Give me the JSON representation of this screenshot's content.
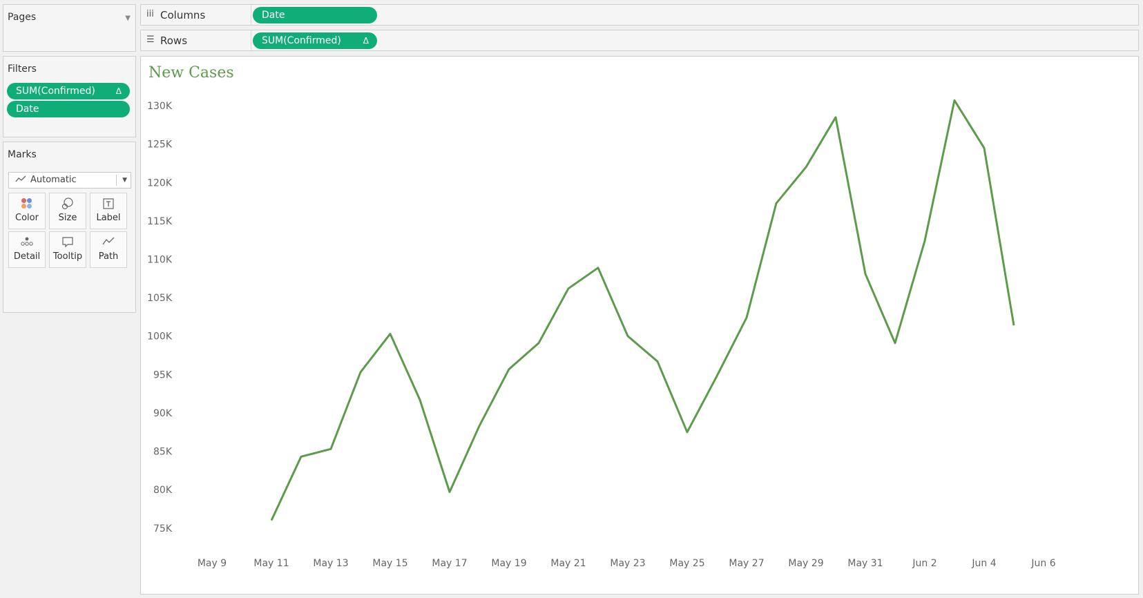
{
  "pages": {
    "title": "Pages"
  },
  "filters": {
    "title": "Filters",
    "pills": [
      {
        "label": "SUM(Confirmed)",
        "badge": "Δ"
      },
      {
        "label": "Date"
      }
    ]
  },
  "marks": {
    "title": "Marks",
    "type_selector": "Automatic",
    "buttons": [
      "Color",
      "Size",
      "Label",
      "Detail",
      "Tooltip",
      "Path"
    ]
  },
  "shelves": {
    "columns": {
      "label": "Columns",
      "pill": "Date"
    },
    "rows": {
      "label": "Rows",
      "pill": "SUM(Confirmed)",
      "badge": "Δ"
    }
  },
  "colors": {
    "accent": "#10ad78",
    "line": "#5d9b4c"
  },
  "chart_data": {
    "type": "line",
    "title": "New Cases",
    "xlabel": "",
    "ylabel": "",
    "x_tick_labels": [
      "May 9",
      "May 11",
      "May 13",
      "May 15",
      "May 17",
      "May 19",
      "May 21",
      "May 23",
      "May 25",
      "May 27",
      "May 29",
      "May 31",
      "Jun 2",
      "Jun 4",
      "Jun 6"
    ],
    "y_tick_labels": [
      "75K",
      "80K",
      "85K",
      "90K",
      "95K",
      "100K",
      "105K",
      "110K",
      "115K",
      "120K",
      "125K",
      "130K"
    ],
    "ylim": [
      73000,
      131000
    ],
    "xlim": [
      "2020-05-08",
      "2020-06-07"
    ],
    "grid": false,
    "series": [
      {
        "x": [
          "2020-05-11",
          "2020-05-12",
          "2020-05-13",
          "2020-05-14",
          "2020-05-15",
          "2020-05-16",
          "2020-05-17",
          "2020-05-18",
          "2020-05-19",
          "2020-05-20",
          "2020-05-21",
          "2020-05-22",
          "2020-05-23",
          "2020-05-24",
          "2020-05-25",
          "2020-05-26",
          "2020-05-27",
          "2020-05-28",
          "2020-05-29",
          "2020-05-30",
          "2020-05-31",
          "2020-06-01",
          "2020-06-02",
          "2020-06-03",
          "2020-06-04",
          "2020-06-05"
        ],
        "values": [
          76000,
          84300,
          85300,
          95300,
          100300,
          91700,
          79700,
          88300,
          95700,
          99100,
          106200,
          108900,
          100000,
          96700,
          87500,
          94800,
          102400,
          117300,
          122000,
          128500,
          108100,
          99100,
          112400,
          130700,
          124500,
          101400
        ]
      }
    ]
  }
}
